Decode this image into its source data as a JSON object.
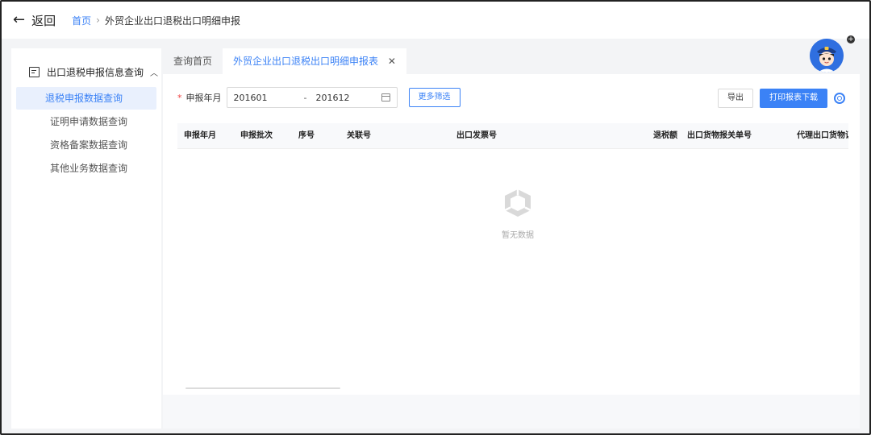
{
  "header": {
    "back_label": "返回",
    "breadcrumb_home": "首页",
    "breadcrumb_separator": "›",
    "breadcrumb_current": "外贸企业出口退税出口明细申报"
  },
  "sidebar": {
    "section_title": "出口退税申报信息查询",
    "items": [
      {
        "label": "退税申报数据查询",
        "active": true
      },
      {
        "label": "证明申请数据查询",
        "active": false
      },
      {
        "label": "资格备案数据查询",
        "active": false
      },
      {
        "label": "其他业务数据查询",
        "active": false
      }
    ]
  },
  "tabs": [
    {
      "label": "查询首页",
      "active": false
    },
    {
      "label": "外贸企业出口退税出口明细申报表",
      "active": true
    }
  ],
  "filters": {
    "required_mark": "*",
    "period_label": "申报年月",
    "period_start": "201601",
    "period_separator": "-",
    "period_end": "201612",
    "more_filters_label": "更多筛选"
  },
  "actions": {
    "export_label": "导出",
    "print_download_label": "打印报表下载"
  },
  "table": {
    "columns": [
      "申报年月",
      "申报批次",
      "序号",
      "关联号",
      "出口发票号",
      "退税额",
      "出口货物报关单号",
      "代理出口货物证"
    ],
    "rows": [],
    "empty_text": "暂无数据"
  },
  "colors": {
    "accent": "#3b82f6",
    "required": "#ef4444"
  }
}
